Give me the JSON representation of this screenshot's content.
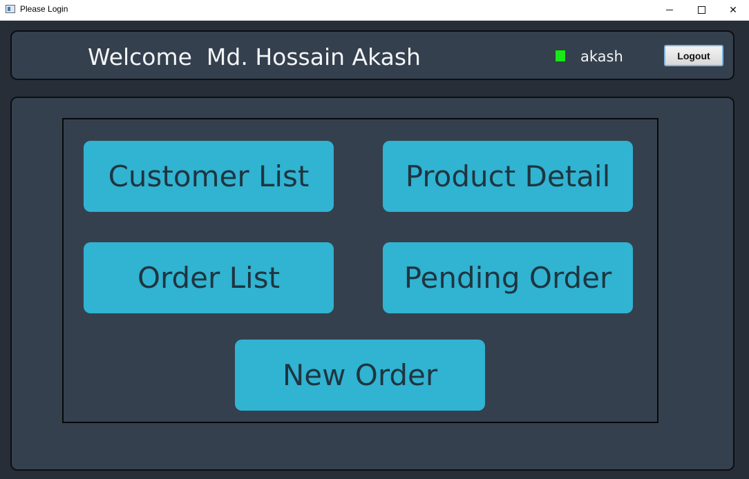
{
  "window": {
    "title": "Please Login",
    "controls": {
      "minimize": "minimize",
      "maximize": "maximize",
      "close": "✕"
    }
  },
  "header": {
    "welcome_text": "Welcome  Md. Hossain Akash",
    "status_color": "#19e71a",
    "username": "akash",
    "logout_label": "Logout"
  },
  "menu": {
    "customer_list": "Customer List",
    "product_detail": "Product Detail",
    "order_list": "Order List",
    "pending_order": "Pending Order",
    "new_order": "New Order"
  },
  "colors": {
    "panel_bg": "#35404e",
    "page_bg": "#272e38",
    "button_bg": "#31b3d2",
    "button_text": "#1f3540"
  }
}
